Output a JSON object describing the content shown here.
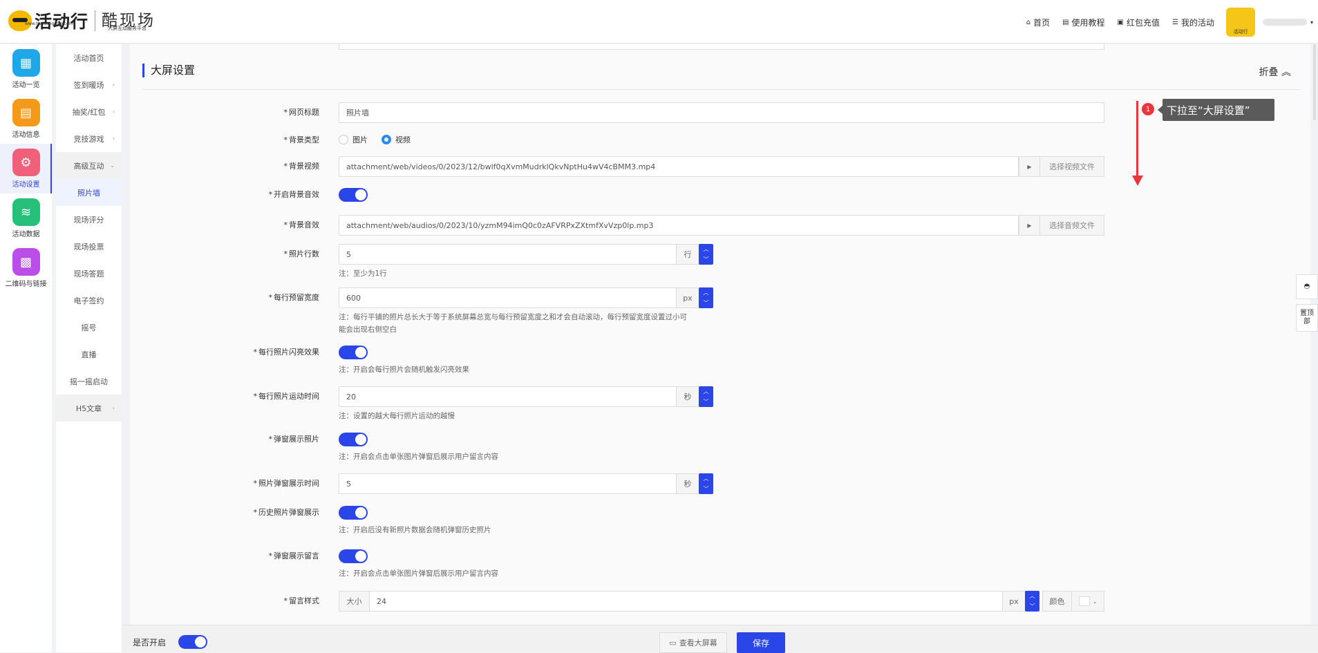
{
  "brand": {
    "logo_text": "活动行",
    "logo_url": "www.huodongcool.com",
    "brand_name": "酷现场",
    "brand_tag": "大屏互动服务平台"
  },
  "nav": [
    {
      "label": "首页",
      "icon": "home-icon"
    },
    {
      "label": "使用教程",
      "icon": "book-icon"
    },
    {
      "label": "红包充值",
      "icon": "wallet-icon"
    },
    {
      "label": "我的活动",
      "icon": "list-icon"
    }
  ],
  "avatar_text": "活动行",
  "rail": [
    {
      "label": "活动一览",
      "color": "#1fa7e8",
      "icon": "grid-icon"
    },
    {
      "label": "活动信息",
      "color": "#f39a1a",
      "icon": "document-icon"
    },
    {
      "label": "活动设置",
      "color": "#f0607a",
      "icon": "gear-icon",
      "active": true
    },
    {
      "label": "活动数据",
      "color": "#26c07a",
      "icon": "database-icon"
    },
    {
      "label": "二维码与链接",
      "color": "#b94ee8",
      "icon": "qrcode-icon"
    }
  ],
  "submenu": [
    {
      "label": "活动首页",
      "arrow": false
    },
    {
      "label": "签到暖场",
      "arrow": true
    },
    {
      "label": "抽奖/红包",
      "arrow": true
    },
    {
      "label": "竞技游戏",
      "arrow": true
    },
    {
      "label": "高级互动",
      "arrow": true,
      "open": true
    },
    {
      "label": "照片墙",
      "active": true
    },
    {
      "label": "现场评分"
    },
    {
      "label": "现场投票"
    },
    {
      "label": "现场答题"
    },
    {
      "label": "电子签约"
    },
    {
      "label": "摇号"
    },
    {
      "label": "直播"
    },
    {
      "label": "摇一摇启动"
    },
    {
      "label": "H5文章",
      "arrow": true
    }
  ],
  "section": {
    "title": "大屏设置",
    "fold_label": "折叠"
  },
  "form": {
    "page_title": {
      "label": "网页标题",
      "value": "照片墙"
    },
    "bg_type": {
      "label": "背景类型",
      "opt_image": "图片",
      "opt_video": "视频",
      "selected": "视频"
    },
    "bg_video": {
      "label": "背景视频",
      "value": "attachment/web/videos/0/2023/12/bwlf0qXvmMudrklQkvNptHu4wV4cBMM3.mp4",
      "pick": "选择视频文件"
    },
    "bg_audio_on": {
      "label": "开启背景音效",
      "on": true
    },
    "bg_audio": {
      "label": "背景音效",
      "value": "attachment/web/audios/0/2023/10/yzmM94imQ0c0zAFVRPxZXtmfXvVzp0lp.mp3",
      "pick": "选择音频文件"
    },
    "rows": {
      "label": "照片行数",
      "value": "5",
      "unit": "行",
      "note": "注：至少为1行"
    },
    "row_width": {
      "label": "每行预留宽度",
      "value": "600",
      "unit": "px",
      "note1": "注：每行平铺的照片总长大于等于系统屏幕总宽与每行预留宽度之和才会自动滚动，每行预留宽度设置过小可",
      "note2": "能会出现右侧空白"
    },
    "flash": {
      "label": "每行照片闪亮效果",
      "on": true,
      "note": "注：开启会每行照片会随机触发闪亮效果"
    },
    "move_time": {
      "label": "每行照片运动时间",
      "value": "20",
      "unit": "秒",
      "note": "注：设置的越大每行照片运动的越慢"
    },
    "popup_photo": {
      "label": "弹窗展示照片",
      "on": true,
      "note": "注：开启会点击单张图片弹窗后展示用户留言内容"
    },
    "popup_time": {
      "label": "照片弹窗展示时间",
      "value": "5",
      "unit": "秒"
    },
    "history": {
      "label": "历史照片弹窗展示",
      "on": true,
      "note": "注：开启后没有新照片数据会随机弹窗历史照片"
    },
    "popup_msg": {
      "label": "弹窗展示留言",
      "on": true,
      "note": "注：开启会点击单张图片弹窗后展示用户留言内容"
    },
    "msg_style": {
      "label": "留言样式",
      "size_label": "大小",
      "size": "24",
      "unit": "px",
      "color_label": "颜色"
    }
  },
  "annotation": {
    "num": "1",
    "text": "下拉至“大屏设置”"
  },
  "footer": {
    "enable_label": "是否开启",
    "view_label": "查看大屏幕",
    "save_label": "保存"
  },
  "side": {
    "qq": "",
    "top": "置顶部"
  }
}
